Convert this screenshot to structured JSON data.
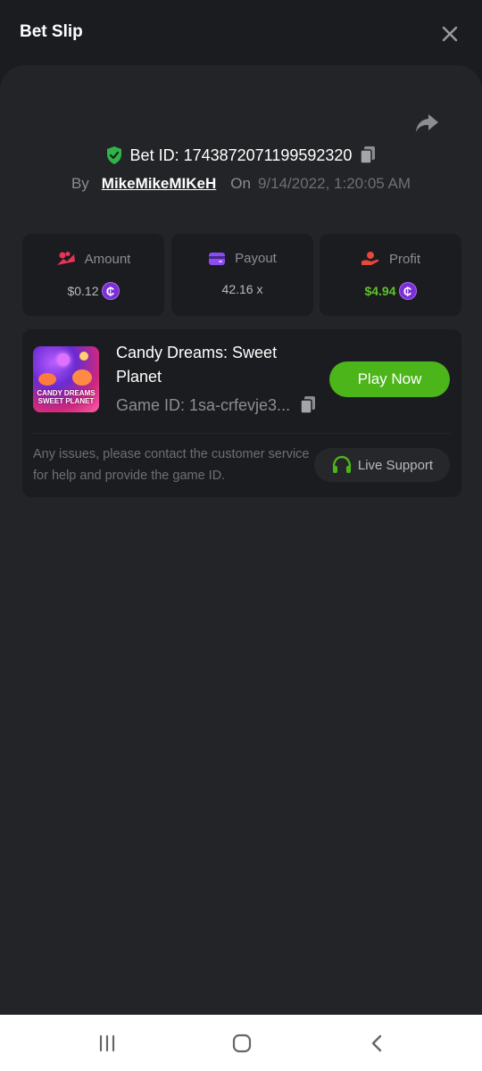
{
  "header": {
    "title": "Bet Slip",
    "close_icon": "close-icon"
  },
  "bet": {
    "bet_id_label": "Bet ID: 1743872071199592320",
    "by_label": "By",
    "user": "MikeMikeMIKeH",
    "on_label": "On",
    "date": "9/14/2022, 1:20:05 AM"
  },
  "stats": {
    "amount": {
      "label": "Amount",
      "value": "$0.12",
      "icon": "amount-coins-icon"
    },
    "payout": {
      "label": "Payout",
      "value": "42.16 x",
      "icon": "wallet-icon"
    },
    "profit": {
      "label": "Profit",
      "value": "$4.94",
      "icon": "profit-hand-icon"
    }
  },
  "coin_symbol": "₵",
  "game": {
    "name": "Candy Dreams: Sweet Planet",
    "game_id": "Game ID: 1sa-crfevje3...",
    "thumbnail_text_1": "CANDY DREAMS",
    "thumbnail_text_2": "SWEET PLANET",
    "play_label": "Play Now",
    "help_text": "Any issues, please contact the customer service for help and provide the game ID.",
    "support_label": "Live Support"
  },
  "colors": {
    "accent_green": "#4cb51a",
    "profit_green": "#5dc32a",
    "coin_purple": "#7b2fd6",
    "amount_red": "#e8345a",
    "payout_purple": "#8b4df0",
    "profit_red": "#e8483a"
  }
}
